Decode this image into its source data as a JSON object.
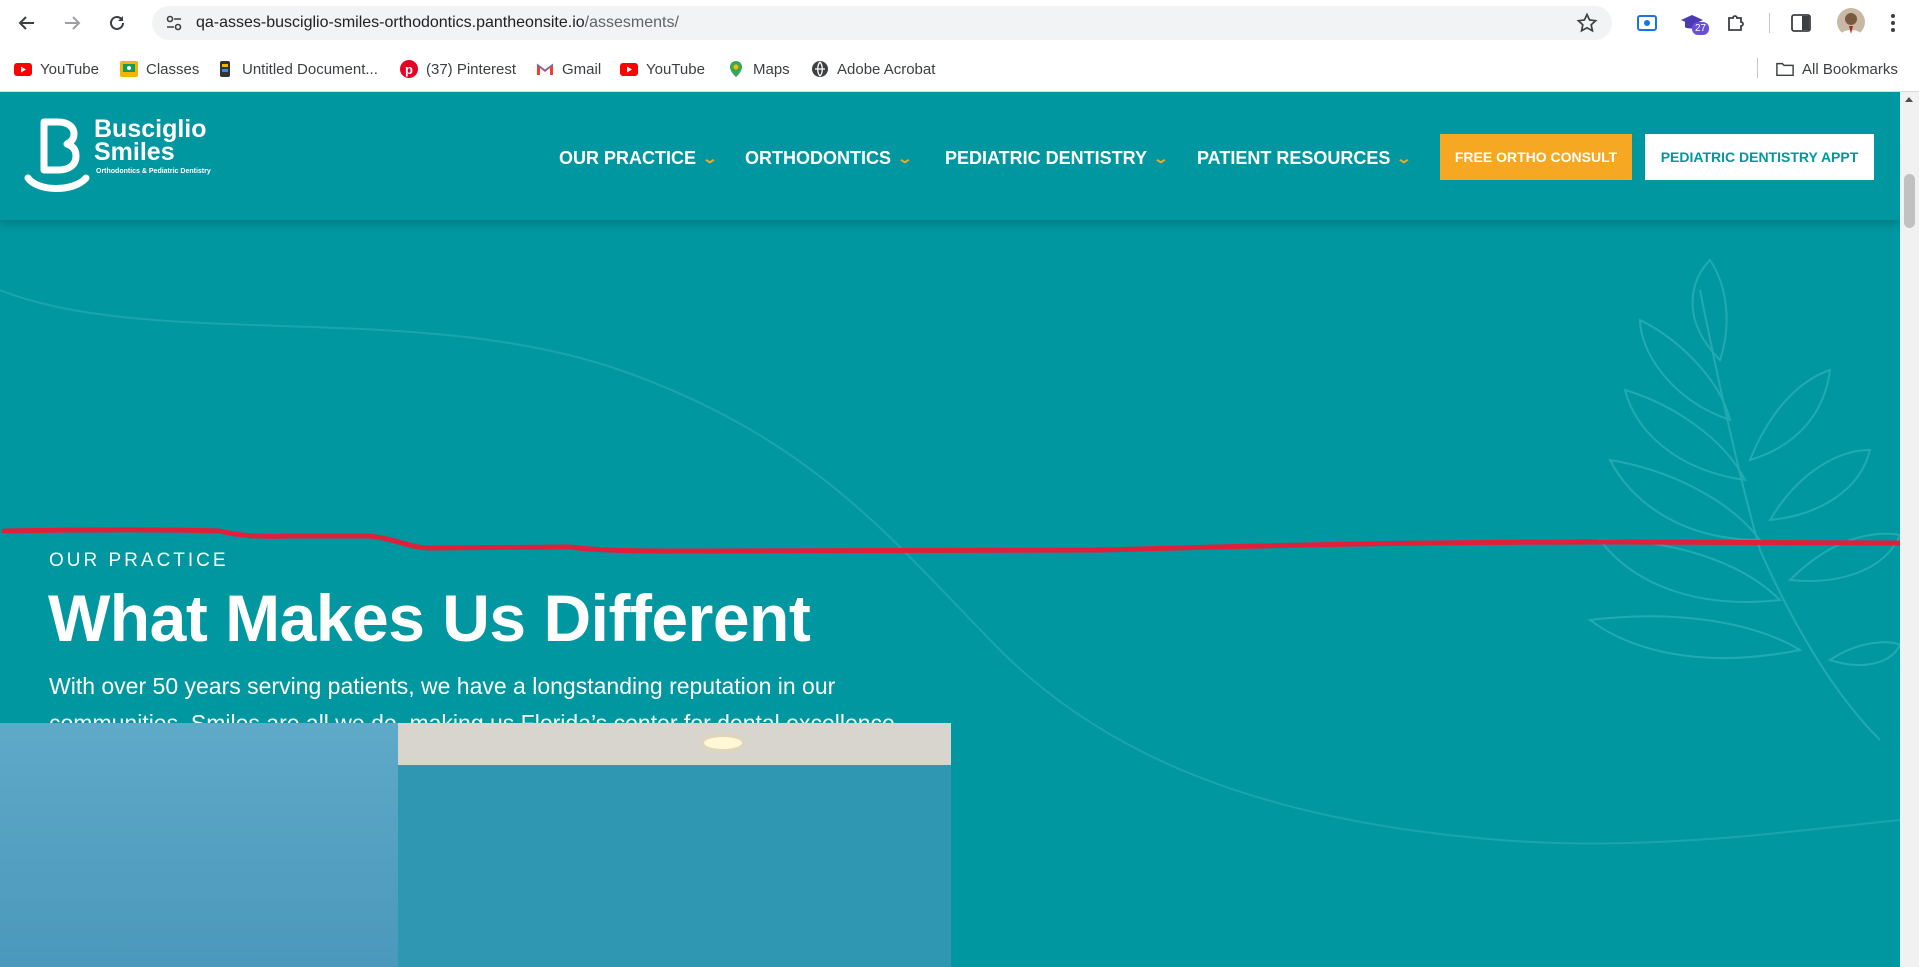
{
  "browser": {
    "url_host": "qa-asses-busciglio-smiles-orthodontics.pantheonsite.io",
    "url_path": "/assesments/",
    "extension_badge": "27",
    "icons": [
      "back-icon",
      "forward-icon",
      "reload-icon",
      "site-info-icon",
      "star-icon",
      "screenshot-extension-icon",
      "graduation-cap-extension-icon",
      "puzzle-extensions-icon",
      "side-panel-icon",
      "profile-avatar",
      "menu-kebab-icon"
    ]
  },
  "bookmarks": {
    "items": [
      {
        "label": "YouTube",
        "icon": "youtube-icon"
      },
      {
        "label": "Classes",
        "icon": "classes-icon"
      },
      {
        "label": "Untitled Document...",
        "icon": "document-icon"
      },
      {
        "label": "(37) Pinterest",
        "icon": "pinterest-icon"
      },
      {
        "label": "Gmail",
        "icon": "gmail-icon"
      },
      {
        "label": "YouTube",
        "icon": "youtube-icon"
      },
      {
        "label": "Maps",
        "icon": "maps-icon"
      },
      {
        "label": "Adobe Acrobat",
        "icon": "globe-icon"
      }
    ],
    "all_bookmarks": "All Bookmarks"
  },
  "site": {
    "logo": {
      "line1": "Busciglio",
      "line2": "Smiles",
      "tagline": "Orthodontics & Pediatric Dentistry"
    },
    "nav": [
      {
        "label": "OUR PRACTICE"
      },
      {
        "label": "ORTHODONTICS"
      },
      {
        "label": "PEDIATRIC DENTISTRY"
      },
      {
        "label": "PATIENT RESOURCES"
      }
    ],
    "cta_primary": "FREE ORTHO CONSULT",
    "cta_secondary": "PEDIATRIC DENTISTRY APPT",
    "colors": {
      "teal": "#0097a0",
      "orange": "#f7a823",
      "annotation_red": "#e0203a"
    }
  },
  "hero": {
    "eyebrow": "OUR PRACTICE",
    "title": "What Makes Us Different",
    "text_line1": "With over 50 years serving patients, we have a longstanding reputation in our",
    "text_line2": "communities. Smiles are all we do, making us Florida’s center for dental excellence."
  }
}
